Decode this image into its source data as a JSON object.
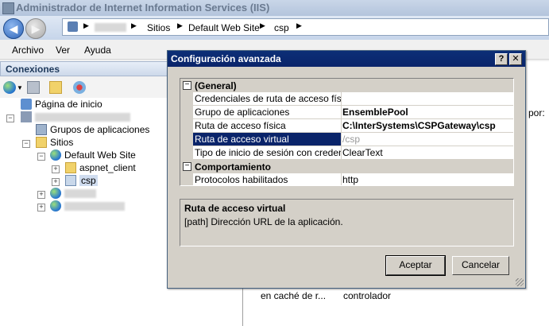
{
  "window": {
    "title": "Administrador de Internet Information Services (IIS)"
  },
  "nav": {
    "back": "◀",
    "forward": "▶",
    "breadcrumb": [
      "Sitios",
      "Default Web Site",
      "csp"
    ],
    "separator": "▶"
  },
  "menu": {
    "items": [
      "Archivo",
      "Ver",
      "Ayuda"
    ]
  },
  "connections": {
    "title": "Conexiones",
    "tree": {
      "start_page": "Página de inicio",
      "app_pools": "Grupos de aplicaciones",
      "sites": "Sitios",
      "default_site": "Default Web Site",
      "aspnet": "aspnet_client",
      "csp": "csp"
    }
  },
  "background": {
    "sort_label": "ar por:",
    "bottom_left": "en caché de r...",
    "bottom_mid": "controlador"
  },
  "dialog": {
    "title": "Configuración avanzada",
    "help": "?",
    "close": "✕",
    "categories": {
      "general": "(General)",
      "behavior": "Comportamiento"
    },
    "collapse_glyph": "−",
    "properties": [
      {
        "name": "Credenciales de ruta de acceso física",
        "value": ""
      },
      {
        "name": "Grupo de aplicaciones",
        "value": "EnsemblePool"
      },
      {
        "name": "Ruta de acceso física",
        "value": "C:\\InterSystems\\CSPGateway\\csp"
      },
      {
        "name": "Ruta de acceso virtual",
        "value": "/csp"
      },
      {
        "name": "Tipo de inicio de sesión con credenciales",
        "value": "ClearText"
      }
    ],
    "behavior_props": [
      {
        "name": "Protocolos habilitados",
        "value": "http"
      }
    ],
    "description": {
      "heading": "Ruta de acceso virtual",
      "text": "[path] Dirección URL de la aplicación."
    },
    "ok": "Aceptar",
    "cancel": "Cancelar"
  }
}
